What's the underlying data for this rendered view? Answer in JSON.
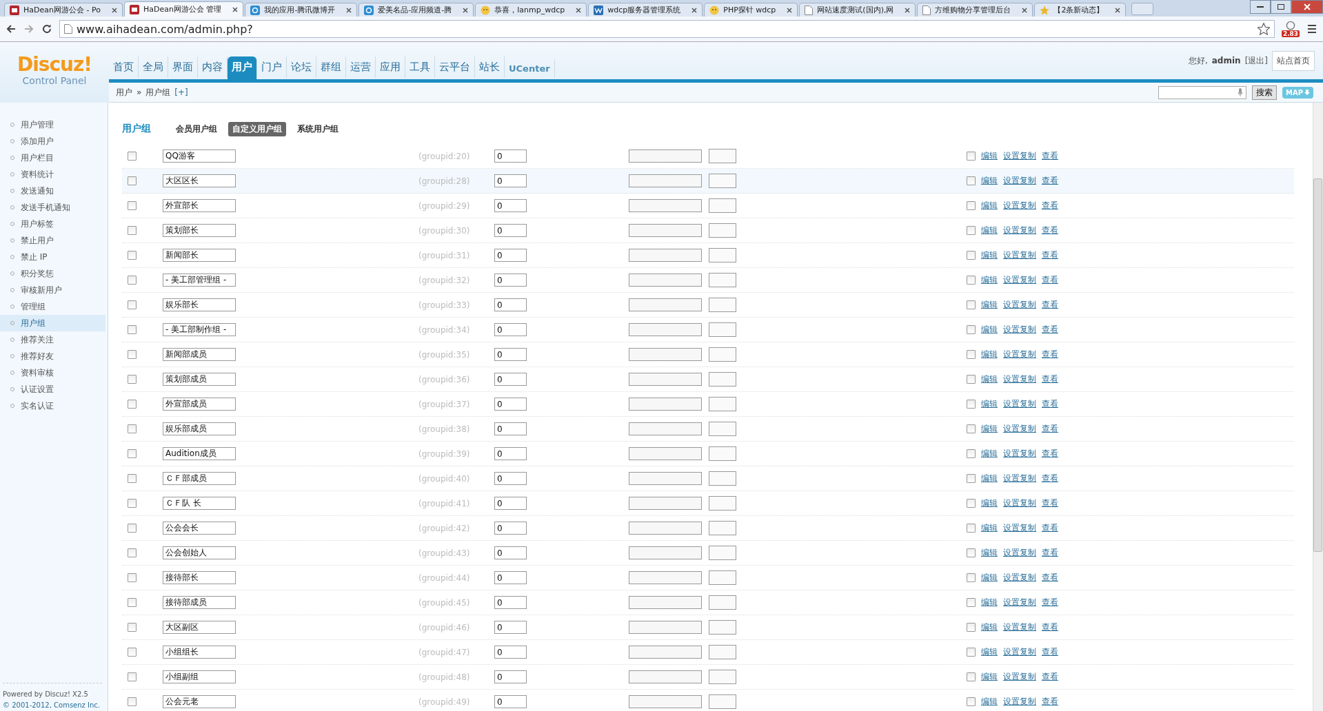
{
  "browser": {
    "tabs": [
      {
        "title": "HaDean网游公会 - Po",
        "selected": false,
        "kind": "hd"
      },
      {
        "title": "HaDean网游公会 管理",
        "selected": true,
        "kind": "hd"
      },
      {
        "title": "我的应用-腾讯微博开",
        "selected": false,
        "kind": "weibo"
      },
      {
        "title": "爱美名品-应用频道-腾",
        "selected": false,
        "kind": "weibo"
      },
      {
        "title": "恭喜，lanmp_wdcp",
        "selected": false,
        "kind": "smile"
      },
      {
        "title": "wdcp服务器管理系统",
        "selected": false,
        "kind": "w"
      },
      {
        "title": "PHP探针 wdcp",
        "selected": false,
        "kind": "smile"
      },
      {
        "title": "网站速度测试(国内),网",
        "selected": false,
        "kind": "page"
      },
      {
        "title": "方维购物分享管理后台",
        "selected": false,
        "kind": "page"
      },
      {
        "title": "【2条新动态】",
        "selected": false,
        "kind": "star"
      }
    ],
    "url": "www.aihadean.com/admin.php?",
    "badge": "2.83"
  },
  "header": {
    "logo": "Discuz!",
    "logo_subtitle": "Control Panel",
    "nav": [
      {
        "label": "首页",
        "selected": false
      },
      {
        "label": "全局",
        "selected": false
      },
      {
        "label": "界面",
        "selected": false
      },
      {
        "label": "内容",
        "selected": false
      },
      {
        "label": "用户",
        "selected": true
      },
      {
        "label": "门户",
        "selected": false
      },
      {
        "label": "论坛",
        "selected": false
      },
      {
        "label": "群组",
        "selected": false
      },
      {
        "label": "运营",
        "selected": false
      },
      {
        "label": "应用",
        "selected": false
      },
      {
        "label": "工具",
        "selected": false
      },
      {
        "label": "云平台",
        "selected": false
      },
      {
        "label": "站长",
        "selected": false
      },
      {
        "label": "UCenter",
        "selected": false
      }
    ],
    "greeting": "您好,",
    "user": "admin",
    "logout": "[退出]",
    "site_home": "站点首页"
  },
  "breadcrumb": {
    "items": [
      "用户",
      "用户组"
    ],
    "separator": "»",
    "add": "[+]",
    "search_button": "搜索",
    "map_button": "MAP"
  },
  "sidebar": {
    "items": [
      {
        "label": "用户管理",
        "selected": false
      },
      {
        "label": "添加用户",
        "selected": false
      },
      {
        "label": "用户栏目",
        "selected": false
      },
      {
        "label": "资料统计",
        "selected": false
      },
      {
        "label": "发送通知",
        "selected": false
      },
      {
        "label": "发送手机通知",
        "selected": false
      },
      {
        "label": "用户标签",
        "selected": false
      },
      {
        "label": "禁止用户",
        "selected": false
      },
      {
        "label": "禁止 IP",
        "selected": false
      },
      {
        "label": "积分奖惩",
        "selected": false
      },
      {
        "label": "审核新用户",
        "selected": false
      },
      {
        "label": "管理组",
        "selected": false
      },
      {
        "label": "用户组",
        "selected": true
      },
      {
        "label": "推荐关注",
        "selected": false
      },
      {
        "label": "推荐好友",
        "selected": false
      },
      {
        "label": "资料审核",
        "selected": false
      },
      {
        "label": "认证设置",
        "selected": false
      },
      {
        "label": "实名认证",
        "selected": false
      }
    ],
    "footer": [
      "Powered by Discuz! X2.5",
      "© 2001-2012, Comsenz Inc."
    ]
  },
  "section": {
    "title": "用户组",
    "tabs": [
      {
        "label": "会员用户组",
        "selected": false
      },
      {
        "label": "自定义用户组",
        "selected": true
      },
      {
        "label": "系统用户组",
        "selected": false
      }
    ]
  },
  "rows": [
    {
      "name": "QQ游客",
      "groupid": "(groupid:20)",
      "order": "0",
      "highlighted": false,
      "checked": false,
      "delete_checked": false,
      "actions": [
        "编辑",
        "设置复制",
        "查看"
      ]
    },
    {
      "name": "大区区长",
      "groupid": "(groupid:28)",
      "order": "0",
      "highlighted": true,
      "checked": false,
      "delete_checked": false,
      "actions": [
        "编辑",
        "设置复制",
        "查看"
      ]
    },
    {
      "name": "外宣部长",
      "groupid": "(groupid:29)",
      "order": "0",
      "highlighted": false,
      "checked": false,
      "delete_checked": false,
      "actions": [
        "编辑",
        "设置复制",
        "查看"
      ]
    },
    {
      "name": "策划部长",
      "groupid": "(groupid:30)",
      "order": "0",
      "highlighted": false,
      "checked": false,
      "delete_checked": false,
      "actions": [
        "编辑",
        "设置复制",
        "查看"
      ]
    },
    {
      "name": "新闻部长",
      "groupid": "(groupid:31)",
      "order": "0",
      "highlighted": false,
      "checked": false,
      "delete_checked": false,
      "actions": [
        "编辑",
        "设置复制",
        "查看"
      ]
    },
    {
      "name": "- 美工部管理组 -",
      "groupid": "(groupid:32)",
      "order": "0",
      "highlighted": false,
      "checked": false,
      "delete_checked": false,
      "actions": [
        "编辑",
        "设置复制",
        "查看"
      ]
    },
    {
      "name": "娱乐部长",
      "groupid": "(groupid:33)",
      "order": "0",
      "highlighted": false,
      "checked": false,
      "delete_checked": false,
      "actions": [
        "编辑",
        "设置复制",
        "查看"
      ]
    },
    {
      "name": "- 美工部制作组 -",
      "groupid": "(groupid:34)",
      "order": "0",
      "highlighted": false,
      "checked": false,
      "delete_checked": false,
      "actions": [
        "编辑",
        "设置复制",
        "查看"
      ]
    },
    {
      "name": "新闻部成员",
      "groupid": "(groupid:35)",
      "order": "0",
      "highlighted": false,
      "checked": false,
      "delete_checked": false,
      "actions": [
        "编辑",
        "设置复制",
        "查看"
      ]
    },
    {
      "name": "策划部成员",
      "groupid": "(groupid:36)",
      "order": "0",
      "highlighted": false,
      "checked": false,
      "delete_checked": false,
      "actions": [
        "编辑",
        "设置复制",
        "查看"
      ]
    },
    {
      "name": "外宣部成员",
      "groupid": "(groupid:37)",
      "order": "0",
      "highlighted": false,
      "checked": false,
      "delete_checked": false,
      "actions": [
        "编辑",
        "设置复制",
        "查看"
      ]
    },
    {
      "name": "娱乐部成员",
      "groupid": "(groupid:38)",
      "order": "0",
      "highlighted": false,
      "checked": false,
      "delete_checked": false,
      "actions": [
        "编辑",
        "设置复制",
        "查看"
      ]
    },
    {
      "name": "Audition成员",
      "groupid": "(groupid:39)",
      "order": "0",
      "highlighted": false,
      "checked": false,
      "delete_checked": false,
      "actions": [
        "编辑",
        "设置复制",
        "查看"
      ]
    },
    {
      "name": "ＣＦ部成员",
      "groupid": "(groupid:40)",
      "order": "0",
      "highlighted": false,
      "checked": false,
      "delete_checked": false,
      "actions": [
        "编辑",
        "设置复制",
        "查看"
      ]
    },
    {
      "name": "ＣＦ队 长",
      "groupid": "(groupid:41)",
      "order": "0",
      "highlighted": false,
      "checked": false,
      "delete_checked": false,
      "actions": [
        "编辑",
        "设置复制",
        "查看"
      ]
    },
    {
      "name": "公会会长",
      "groupid": "(groupid:42)",
      "order": "0",
      "highlighted": false,
      "checked": false,
      "delete_checked": false,
      "actions": [
        "编辑",
        "设置复制",
        "查看"
      ]
    },
    {
      "name": "公会创始人",
      "groupid": "(groupid:43)",
      "order": "0",
      "highlighted": false,
      "checked": false,
      "delete_checked": false,
      "actions": [
        "编辑",
        "设置复制",
        "查看"
      ]
    },
    {
      "name": "接待部长",
      "groupid": "(groupid:44)",
      "order": "0",
      "highlighted": false,
      "checked": false,
      "delete_checked": false,
      "actions": [
        "编辑",
        "设置复制",
        "查看"
      ]
    },
    {
      "name": "接待部成员",
      "groupid": "(groupid:45)",
      "order": "0",
      "highlighted": false,
      "checked": false,
      "delete_checked": false,
      "actions": [
        "编辑",
        "设置复制",
        "查看"
      ]
    },
    {
      "name": "大区副区",
      "groupid": "(groupid:46)",
      "order": "0",
      "highlighted": false,
      "checked": false,
      "delete_checked": false,
      "actions": [
        "编辑",
        "设置复制",
        "查看"
      ]
    },
    {
      "name": "小组组长",
      "groupid": "(groupid:47)",
      "order": "0",
      "highlighted": false,
      "checked": false,
      "delete_checked": false,
      "actions": [
        "编辑",
        "设置复制",
        "查看"
      ]
    },
    {
      "name": "小组副组",
      "groupid": "(groupid:48)",
      "order": "0",
      "highlighted": false,
      "checked": false,
      "delete_checked": false,
      "actions": [
        "编辑",
        "设置复制",
        "查看"
      ]
    },
    {
      "name": "公会元老",
      "groupid": "(groupid:49)",
      "order": "0",
      "highlighted": false,
      "checked": false,
      "delete_checked": false,
      "actions": [
        "编辑",
        "设置复制",
        "查看"
      ]
    }
  ]
}
